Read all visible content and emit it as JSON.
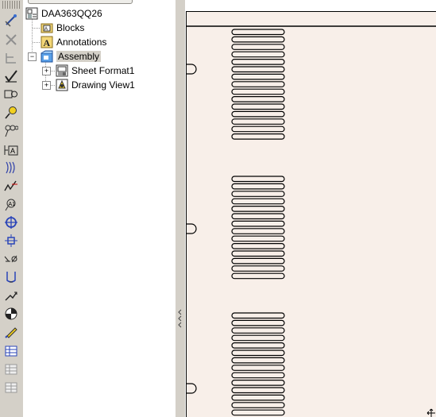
{
  "tree": {
    "root_label": "DAA363QQ26",
    "items": [
      {
        "label": "Blocks",
        "icon": "blocks-folder-icon"
      },
      {
        "label": "Annotations",
        "icon": "annotations-icon"
      },
      {
        "label": "Assembly",
        "icon": "assembly-icon",
        "expanded": true,
        "selected": true
      },
      {
        "label": "Sheet Format1",
        "icon": "sheet-format-icon",
        "expanded": false
      },
      {
        "label": "Drawing View1",
        "icon": "drawing-view-icon",
        "expanded": false
      }
    ]
  },
  "toolbar": {
    "icons": [
      "smart-dimension-icon",
      "trim-icon",
      "ordinate-icon",
      "check-icon",
      "note-box-icon",
      "balloon-icon",
      "auto-balloon-icon",
      "text-annotation-icon",
      "hatch-icon",
      "surface-finish-icon",
      "weld-symbol-icon",
      "center-mark-icon",
      "datum-feature-icon",
      "geometric-tolerance-icon",
      "hole-callout-icon",
      "model-items-icon",
      "datum-target-icon",
      "revision-cloud-icon",
      "table-icon",
      "bom-table-icon",
      "hole-table-icon"
    ]
  },
  "colors": {
    "sheet_background": "#f8efe9",
    "toolbar_background": "#d4d0c8",
    "selected_background": "#d4d0c8",
    "line": "#000000"
  }
}
